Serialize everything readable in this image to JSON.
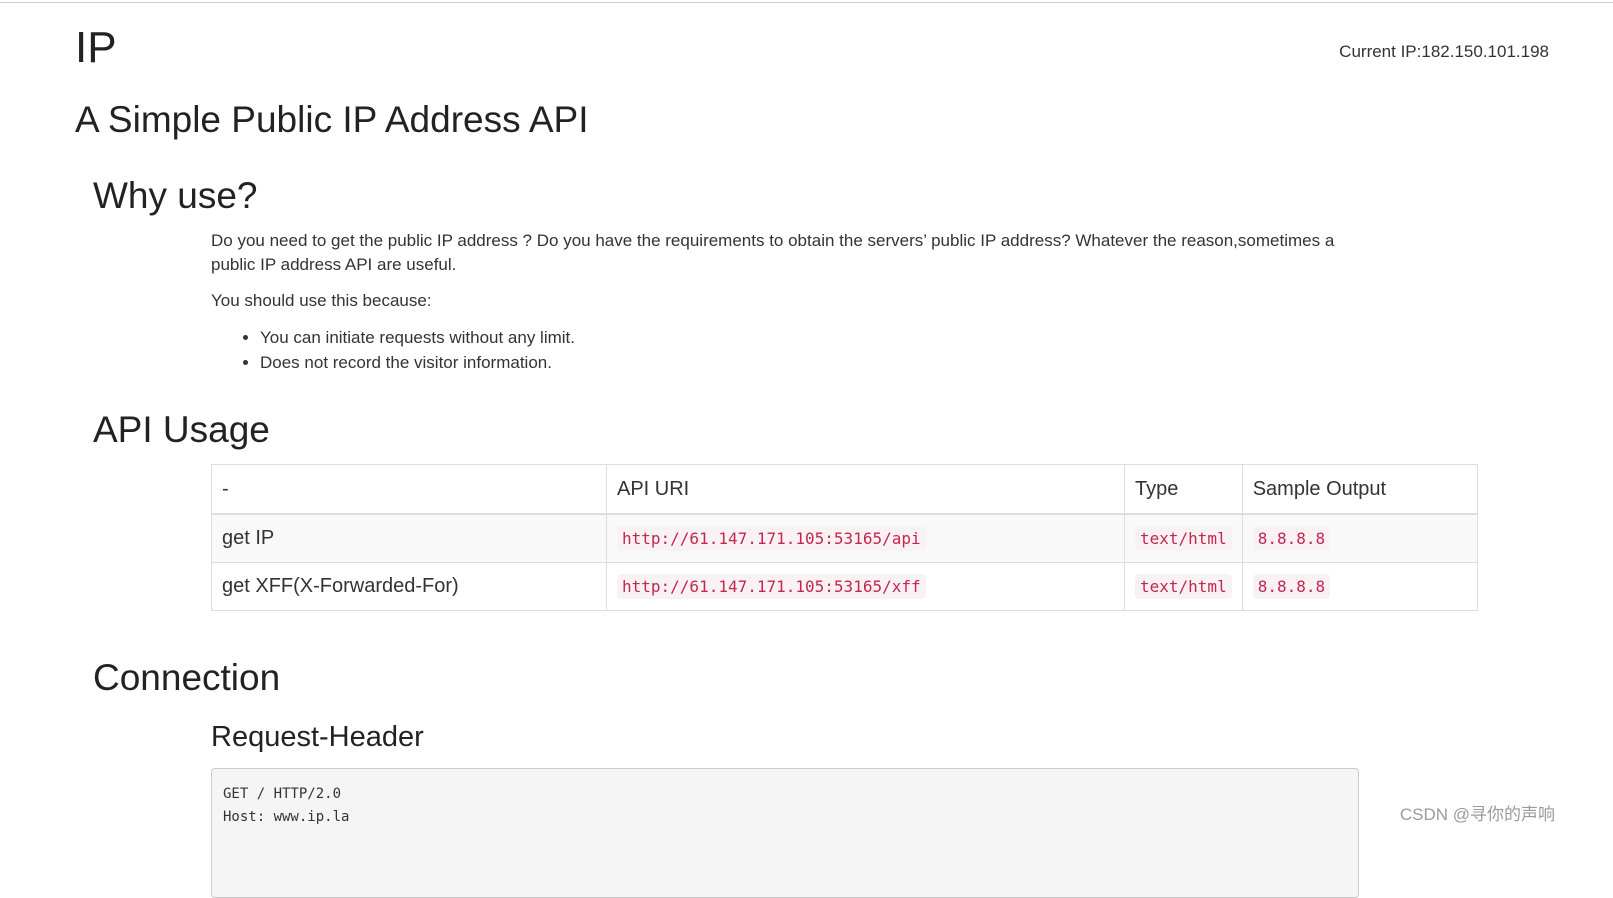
{
  "header": {
    "brand": "IP",
    "current_ip_label": "Current IP:",
    "current_ip_value": "182.150.101.198",
    "subtitle": "A Simple Public IP Address API"
  },
  "why": {
    "title": "Why use?",
    "paragraph": "Do you need to get the public IP address ? Do you have the requirements to obtain the servers’ public IP address? Whatever the reason,sometimes a public IP address API are useful.",
    "lead": "You should use this because:",
    "bullets": [
      "You can initiate requests without any limit.",
      "Does not record the visitor information."
    ]
  },
  "usage": {
    "title": "API Usage",
    "columns": [
      "-",
      "API URI",
      "Type",
      "Sample Output"
    ],
    "rows": [
      {
        "name": "get IP",
        "uri": "http://61.147.171.105:53165/api",
        "type": "text/html",
        "sample": "8.8.8.8"
      },
      {
        "name": "get XFF(X-Forwarded-For)",
        "uri": "http://61.147.171.105:53165/xff",
        "type": "text/html",
        "sample": "8.8.8.8"
      }
    ]
  },
  "connection": {
    "title": "Connection",
    "request_header_title": "Request-Header",
    "request_header_lines": [
      "GET / HTTP/2.0",
      "Host: www.ip.la"
    ]
  },
  "watermark": "CSDN @寻你的声响"
}
